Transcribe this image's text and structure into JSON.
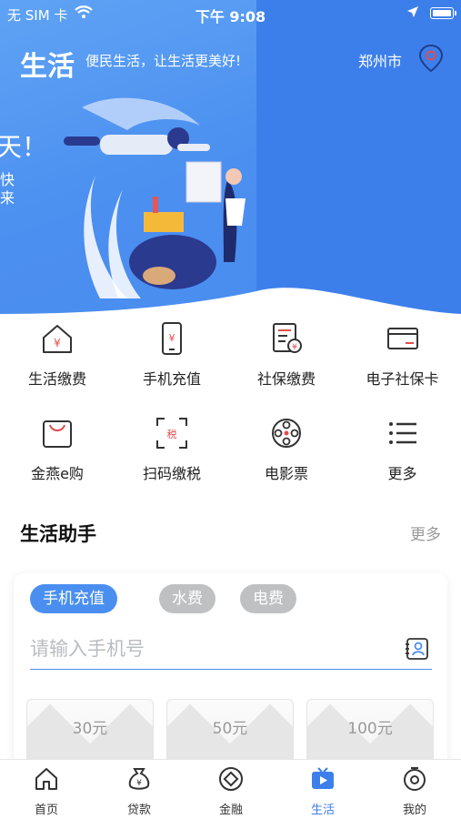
{
  "status_bar": {
    "carrier": "无 SIM 卡",
    "time": "下午 9:08"
  },
  "header": {
    "title": "生活",
    "slogan": "便民生活，让生活更美好!",
    "city": "郑州市"
  },
  "banner": {
    "text_large": "天！",
    "text_small_1": "快",
    "text_small_2": "来"
  },
  "services": [
    {
      "label": "生活缴费",
      "icon": "house-yuan-icon"
    },
    {
      "label": "手机充值",
      "icon": "phone-yuan-icon"
    },
    {
      "label": "社保缴费",
      "icon": "document-yuan-icon"
    },
    {
      "label": "电子社保卡",
      "icon": "card-icon"
    },
    {
      "label": "金燕e购",
      "icon": "shopping-bag-icon"
    },
    {
      "label": "扫码缴税",
      "icon": "scan-tax-icon"
    },
    {
      "label": "电影票",
      "icon": "film-reel-icon"
    },
    {
      "label": "更多",
      "icon": "list-icon"
    }
  ],
  "assistant": {
    "title": "生活助手",
    "more": "更多",
    "tabs": [
      "手机充值",
      "水费",
      "电费"
    ],
    "phone_placeholder": "请输入手机号",
    "amounts": [
      "30元",
      "50元",
      "100元"
    ]
  },
  "tabbar": [
    {
      "label": "首页",
      "icon": "home-icon"
    },
    {
      "label": "贷款",
      "icon": "money-bag-icon"
    },
    {
      "label": "金融",
      "icon": "finance-icon"
    },
    {
      "label": "生活",
      "icon": "tv-play-icon"
    },
    {
      "label": "我的",
      "icon": "profile-icon"
    }
  ],
  "colors": {
    "accent": "#3d7fea",
    "banner": "#4a8ff0"
  }
}
